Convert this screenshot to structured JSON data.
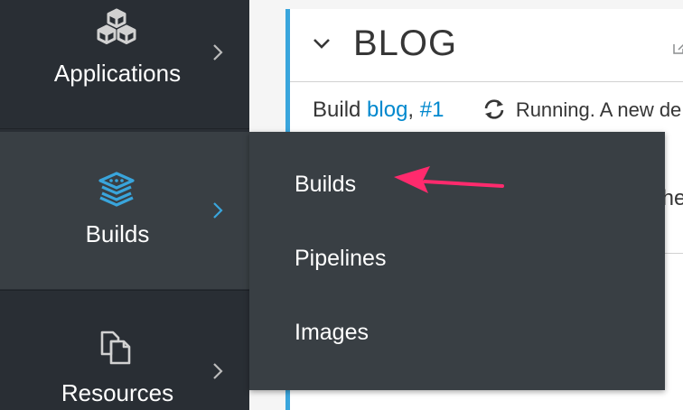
{
  "nav": {
    "items": [
      {
        "label": "Applications"
      },
      {
        "label": "Builds"
      },
      {
        "label": "Resources"
      }
    ]
  },
  "card": {
    "title": "BLOG",
    "build_prefix": "Build",
    "build_link": "blog",
    "build_sep": ",",
    "build_number": "#1",
    "status": "Running. A new de",
    "row2_text": "the"
  },
  "flyout": {
    "items": [
      {
        "label": "Builds"
      },
      {
        "label": "Pipelines"
      },
      {
        "label": "Images"
      }
    ]
  },
  "colors": {
    "nav_bg": "#292e34",
    "nav_active": "#393f44",
    "accent_blue": "#39a5dc",
    "link": "#0088ce",
    "arrow": "#ff2a6d"
  }
}
